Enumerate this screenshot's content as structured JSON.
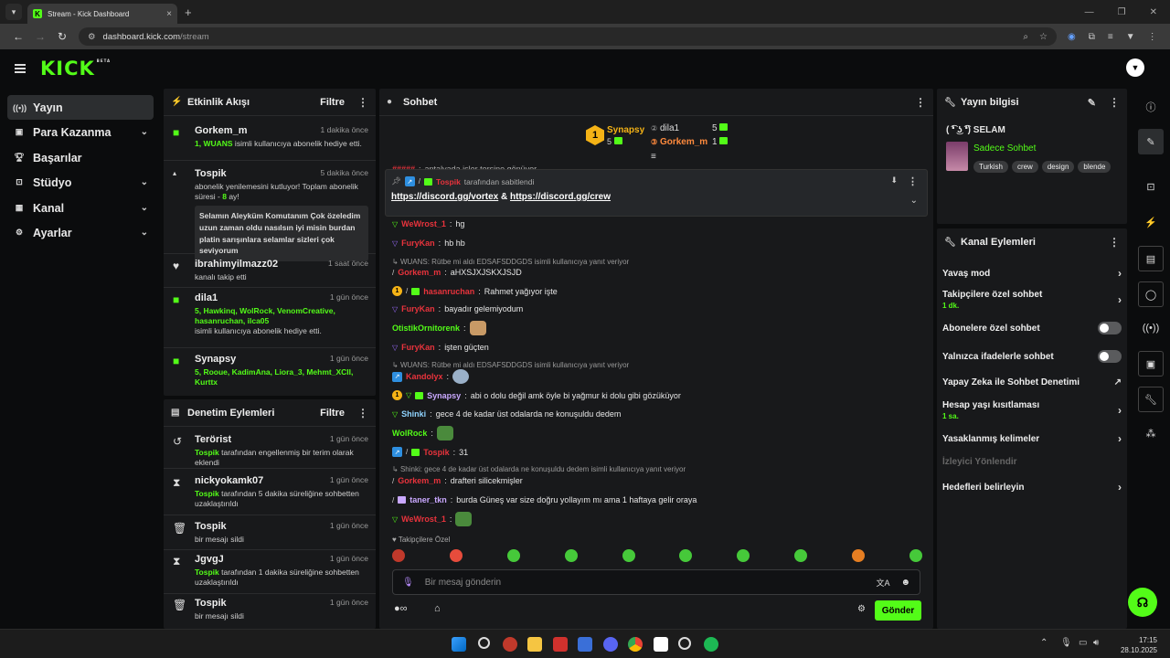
{
  "browser": {
    "tab_title": "Stream - Kick Dashboard",
    "url_host": "dashboard.kick.com",
    "url_path": "/stream"
  },
  "header": {
    "logo": "KICK",
    "beta": "BETA"
  },
  "sidebar": {
    "items": [
      {
        "label": "Yayın",
        "icon": "broadcast-icon"
      },
      {
        "label": "Para Kazanma",
        "icon": "money-icon"
      },
      {
        "label": "Başarılar",
        "icon": "trophy-icon"
      },
      {
        "label": "Stüdyo",
        "icon": "studio-icon"
      },
      {
        "label": "Kanal",
        "icon": "channel-icon"
      },
      {
        "label": "Ayarlar",
        "icon": "gear-icon"
      }
    ]
  },
  "activity": {
    "title": "Etkinlik Akışı",
    "filter": "Filtre",
    "events": [
      {
        "name": "Gorkem_m",
        "time": "1 dakika önce",
        "highlight": "1, WUANS",
        "text": " isimli kullanıcıya abonelik hediye etti."
      },
      {
        "name": "Tospik",
        "time": "5 dakika önce",
        "text": "abonelik yenilemesini kutluyor! Toplam abonelik süresi - ",
        "highlight": "8",
        "text2": " ay!",
        "quote": "Selamın Aleyküm Komutanım Çok özeledim uzun zaman oldu nasılsın iyi misin burdan platin sarışınlara selamlar sizleri çok seviyorum"
      },
      {
        "name": "ibrahimyilmazz02",
        "time": "1 saat önce",
        "text": "kanalı takip etti"
      },
      {
        "name": "dila1",
        "time": "1 gün önce",
        "highlight": "5, Hawkinq, WolRock, VenomCreative, hasanruchan, ilca05",
        "text": "isimli kullanıcıya abonelik hediye etti."
      },
      {
        "name": "Synapsy",
        "time": "1 gün önce",
        "highlight": "5, Rooue, KadimAna, Liora_3, Mehmt_XCII, Kurttx",
        "text": ""
      }
    ]
  },
  "moderation": {
    "title": "Denetim Eylemleri",
    "filter": "Filtre",
    "events": [
      {
        "name": "Terörist",
        "time": "1 gün önce",
        "by": "Tospik",
        "text": " tarafından engellenmiş bir terim olarak eklendi"
      },
      {
        "name": "nickyokamk07",
        "time": "1 gün önce",
        "by": "Tospik",
        "text": " tarafından 5 dakika süreliğine sohbetten uzaklaştırıldı"
      },
      {
        "name": "Tospik",
        "time": "1 gün önce",
        "text": "bir mesajı sildi"
      },
      {
        "name": "JgvgJ",
        "time": "1 gün önce",
        "by": "Tospik",
        "text": " tarafından 1 dakika süreliğine sohbetten uzaklaştırıldı"
      },
      {
        "name": "Tospik",
        "time": "1 gün önce",
        "text": "bir mesajı sildi"
      }
    ]
  },
  "chat": {
    "title": "Sohbet",
    "leaders": {
      "first": {
        "rank": "1",
        "name": "Synapsy",
        "count": "5"
      },
      "second": {
        "name": "dila1",
        "count": "5"
      },
      "third": {
        "name": "Gorkem_m",
        "count": "1"
      }
    },
    "partial_top": "antalyada işler tersine gönüyor",
    "pinned": {
      "by": "Tospik",
      "by_text": " tarafından sabitlendi",
      "link1": "https://discord.gg/vortex",
      "amp": " & ",
      "link2": "https://discord.gg/crew"
    },
    "messages": [
      {
        "user": "WeWrost_1",
        "text": "hg"
      },
      {
        "user": "FuryKan",
        "text": "hb hb"
      },
      {
        "reply": "WUANS: Rütbe mi aldı EDSAFSDDGDS isimli kullanıcıya yanıt veriyor"
      },
      {
        "user": "Gorkem_m",
        "text": "aHXSJXJSKXJSJD"
      },
      {
        "user": "hasanruchan",
        "text": "Rahmet yağıyor işte"
      },
      {
        "user": "FuryKan",
        "text": "bayadır gelemiyodum"
      },
      {
        "user": "OtistikOrnitorenk",
        "text": ""
      },
      {
        "user": "FuryKan",
        "text": "işten güçten"
      },
      {
        "reply": "WUANS: Rütbe mi aldı EDSAFSDDGDS isimli kullanıcıya yanıt veriyor"
      },
      {
        "user": "Kandolyx",
        "text": ""
      },
      {
        "user": "Synapsy",
        "text": "abi o dolu değil amk öyle bi yağmur ki dolu gibi gözüküyor"
      },
      {
        "user": "Shinki",
        "text": "gece 4 de kadar üst odalarda ne konuşuldu dedem"
      },
      {
        "user": "WolRock",
        "text": ""
      },
      {
        "user": "Tospik",
        "text": "31"
      },
      {
        "reply": "Shinki: gece 4 de kadar üst odalarda ne konuşuldu dedem isimli kullanıcıya yanıt veriyor"
      },
      {
        "user": "Gorkem_m",
        "text": "drafteri silicekmişler"
      },
      {
        "user": "taner_tkn",
        "text": "burda Güneş var size doğru yollayım mı ama 1 haftaya gelir oraya"
      },
      {
        "user": "WeWrost_1",
        "text": ""
      }
    ],
    "followers_only": "Takipçilere Özel",
    "input_placeholder": "Bir mesaj gönderin",
    "send": "Gönder"
  },
  "stream_info": {
    "title": "Yayın bilgisi",
    "stream_title": "( ͡❛ ͜ʖ ͡❛) SELAM",
    "category": "Sadece Sohbet",
    "tags": [
      "Turkish",
      "crew",
      "design",
      "blende"
    ]
  },
  "channel_actions": {
    "title": "Kanal Eylemleri",
    "items": [
      {
        "label": "Yavaş mod",
        "type": "chevron"
      },
      {
        "label": "Takipçilere özel sohbet",
        "sub": "1 dk.",
        "type": "chevron"
      },
      {
        "label": "Abonelere özel sohbet",
        "type": "toggle"
      },
      {
        "label": "Yalnızca ifadelerle sohbet",
        "type": "toggle"
      },
      {
        "label": "Yapay Zeka ile Sohbet Denetimi",
        "type": "external"
      },
      {
        "label": "Hesap yaşı kısıtlaması",
        "sub": "1 sa.",
        "type": "chevron"
      },
      {
        "label": "Yasaklanmış kelimeler",
        "type": "chevron"
      },
      {
        "label": "İzleyici Yönlendir",
        "type": "disabled"
      },
      {
        "label": "Hedefleri belirleyin",
        "type": "chevron"
      }
    ]
  },
  "taskbar": {
    "time": "17:15",
    "date": "28.10.2025"
  },
  "colors": {
    "accent": "#53fc18",
    "panel": "#18191b",
    "bg": "#0b0c0d"
  }
}
